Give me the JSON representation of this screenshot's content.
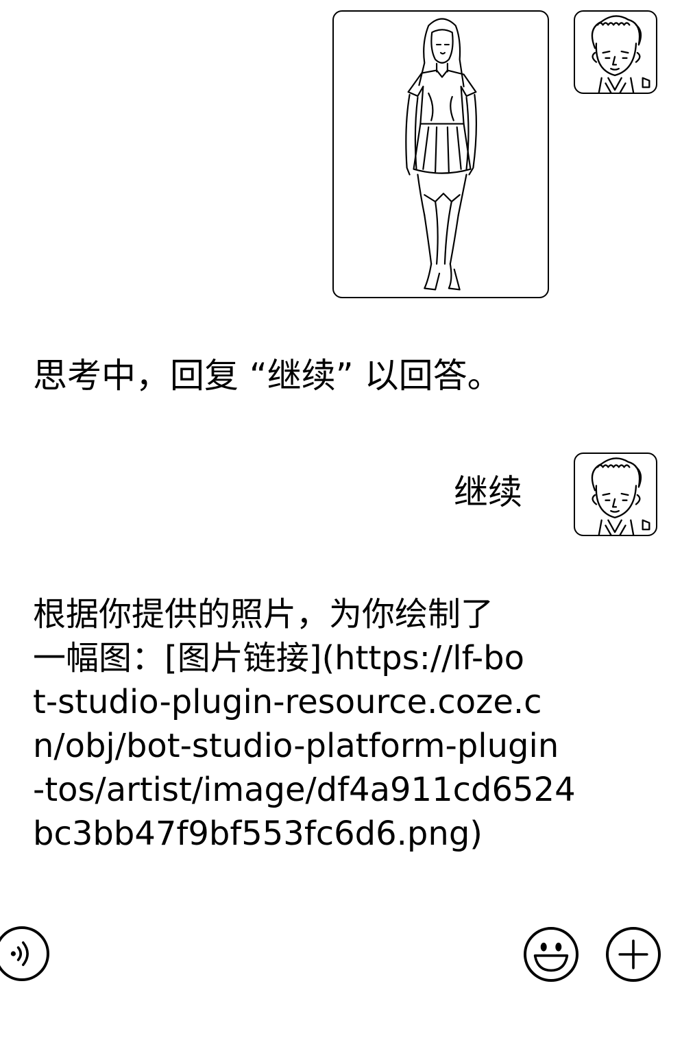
{
  "chat": {
    "messages": [
      {
        "role": "user",
        "type": "image",
        "image_icon": "woman-full-body-photo"
      },
      {
        "role": "bot",
        "type": "text",
        "text": "思考中，回复 “继续” 以回答。"
      },
      {
        "role": "user",
        "type": "text",
        "text": "继续"
      },
      {
        "role": "bot",
        "type": "text",
        "lines": [
          "根据你提供的照片，为你绘制了",
          "一幅图：[图片链接](https://lf-bo",
          "t-studio-plugin-resource.coze.c",
          "n/obj/bot-studio-platform-plugin",
          "-tos/artist/image/df4a911cd6524",
          "bc3bb47f9bf553fc6d6.png)"
        ]
      }
    ],
    "user_avatar_icon": "cartoon-man-avatar"
  },
  "input_bar": {
    "voice_icon": "voice-icon",
    "emoji_icon": "emoji-icon",
    "plus_icon": "plus-icon"
  }
}
